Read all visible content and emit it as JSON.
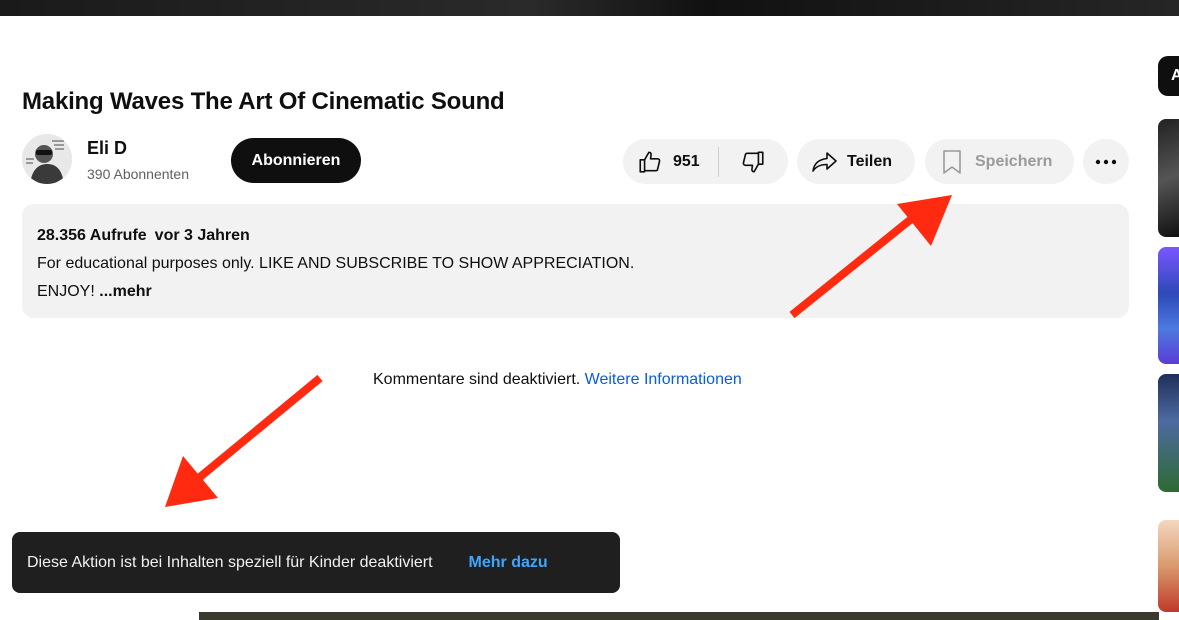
{
  "video": {
    "title": "Making Waves The Art Of Cinematic Sound"
  },
  "channel": {
    "name": "Eli D",
    "subscribers": "390 Abonnenten",
    "subscribe_label": "Abonnieren"
  },
  "actions": {
    "like_count": "951",
    "share_label": "Teilen",
    "save_label": "Speichern"
  },
  "description": {
    "views": "28.356 Aufrufe",
    "age": "vor 3 Jahren",
    "line1": "For educational purposes only. LIKE AND SUBSCRIBE TO SHOW APPRECIATION.",
    "line2": "ENJOY!",
    "more_label": "...mehr"
  },
  "comments": {
    "message": "Kommentare sind deaktiviert.",
    "link": "Weitere Informationen"
  },
  "toast": {
    "message": "Diese Aktion ist bei Inhalten speziell für Kinder deaktiviert",
    "action": "Mehr dazu"
  },
  "right_rail": {
    "chip_label": "A"
  },
  "colors": {
    "annotation_arrow": "#ff2a10",
    "link_blue": "#065fd4",
    "toast_action": "#3ea6ff",
    "pill_bg": "#f2f2f2"
  }
}
